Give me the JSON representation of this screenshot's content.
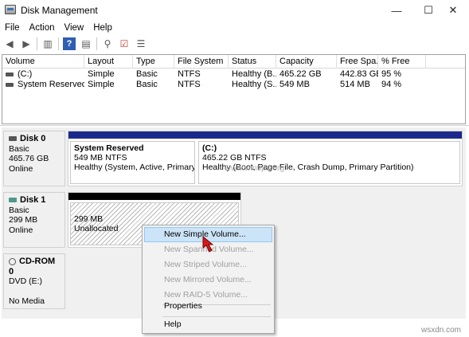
{
  "window": {
    "title": "Disk Management",
    "minimize": "—",
    "maximize": "☐",
    "close": "✕"
  },
  "menu": [
    "File",
    "Action",
    "View",
    "Help"
  ],
  "toolbar": {
    "icons": [
      {
        "name": "back-arrow-icon",
        "glyph": "◀"
      },
      {
        "name": "forward-arrow-icon",
        "glyph": "▶"
      },
      {
        "name": "console-tree-icon",
        "glyph": "▥"
      },
      {
        "name": "help-icon",
        "glyph": "?"
      },
      {
        "name": "properties-icon",
        "glyph": "▤"
      },
      {
        "name": "connect-icon",
        "glyph": "⚲"
      },
      {
        "name": "checklist-icon",
        "glyph": "☑"
      },
      {
        "name": "list-icon",
        "glyph": "☰"
      }
    ]
  },
  "columns": [
    "Volume",
    "Layout",
    "Type",
    "File System",
    "Status",
    "Capacity",
    "Free Spa...",
    "% Free"
  ],
  "volumes": [
    [
      "(C:)",
      "Simple",
      "Basic",
      "NTFS",
      "Healthy (B...",
      "465.22 GB",
      "442.83 GB",
      "95 %"
    ],
    [
      "System Reserved",
      "Simple",
      "Basic",
      "NTFS",
      "Healthy (S...",
      "549 MB",
      "514 MB",
      "94 %"
    ]
  ],
  "disks": [
    {
      "name": "Disk 0",
      "type": "Basic",
      "size": "465.76 GB",
      "status": "Online",
      "partitions": [
        {
          "name": "System Reserved",
          "size": "549 MB NTFS",
          "status": "Healthy (System, Active, Primary Pa"
        },
        {
          "name": "(C:)",
          "size": "465.22 GB NTFS",
          "status": "Healthy (Boot, Page File, Crash Dump, Primary Partition)"
        }
      ]
    },
    {
      "name": "Disk 1",
      "type": "Basic",
      "size": "299 MB",
      "status": "Online",
      "partitions": [
        {
          "size": "299 MB",
          "status": "Unallocated"
        }
      ]
    },
    {
      "name": "CD-ROM 0",
      "type": "DVD (E:)",
      "status": "No Media"
    }
  ],
  "context_menu": {
    "new_simple": "New Simple Volume...",
    "new_spanned": "New Spanned Volume...",
    "new_striped": "New Striped Volume...",
    "new_mirrored": "New Mirrored Volume...",
    "new_raid5": "New RAID-5 Volume...",
    "properties": "Properties",
    "help": "Help"
  },
  "overlay": {
    "center_watermark": "www.wintips.org",
    "corner_watermark": "wsxdn.com"
  },
  "colors": {
    "primary_bar": "#1b2a8a",
    "unallocated_bar": "#000000",
    "menu_highlight": "#cce4f7"
  }
}
